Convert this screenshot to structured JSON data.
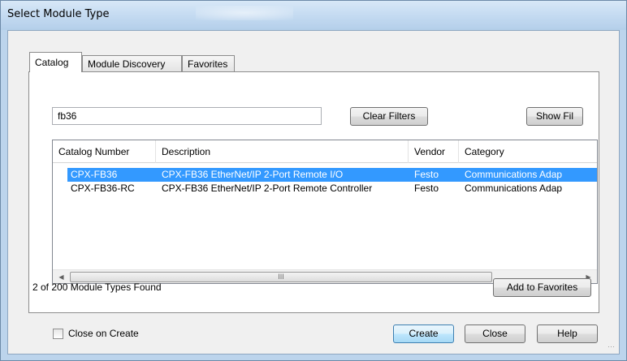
{
  "window": {
    "title": "Select Module Type"
  },
  "tabs": [
    {
      "label": "Catalog",
      "active": true
    },
    {
      "label": "Module Discovery",
      "active": false
    },
    {
      "label": "Favorites",
      "active": false
    }
  ],
  "filter": {
    "search_value": "fb36",
    "clear_filters_label": "Clear Filters",
    "show_filters_label": "Show Fil"
  },
  "table": {
    "columns": [
      "Catalog Number",
      "Description",
      "Vendor",
      "Category"
    ],
    "rows": [
      {
        "catalog_number": "CPX-FB36",
        "description": "CPX-FB36 EtherNet/IP 2-Port Remote I/O",
        "vendor": "Festo",
        "category": "Communications Adap",
        "selected": true
      },
      {
        "catalog_number": "CPX-FB36-RC",
        "description": "CPX-FB36 EtherNet/IP 2-Port Remote Controller",
        "vendor": "Festo",
        "category": "Communications Adap",
        "selected": false
      }
    ],
    "scroll_grip": "III"
  },
  "status": {
    "found_text": "2  of 200 Module Types Found"
  },
  "add_to_favorites_label": "Add to Favorites",
  "footer": {
    "close_on_create_label": "Close on Create",
    "close_on_create_checked": false,
    "create_label": "Create",
    "close_label": "Close",
    "help_label": "Help"
  },
  "colors": {
    "selection": "#3399ff",
    "titlebar": "#c6dcf2"
  },
  "icons": {
    "scroll_left": "triangle-left-icon",
    "scroll_right": "triangle-right-icon",
    "resize_grip": "resize-grip-icon"
  }
}
